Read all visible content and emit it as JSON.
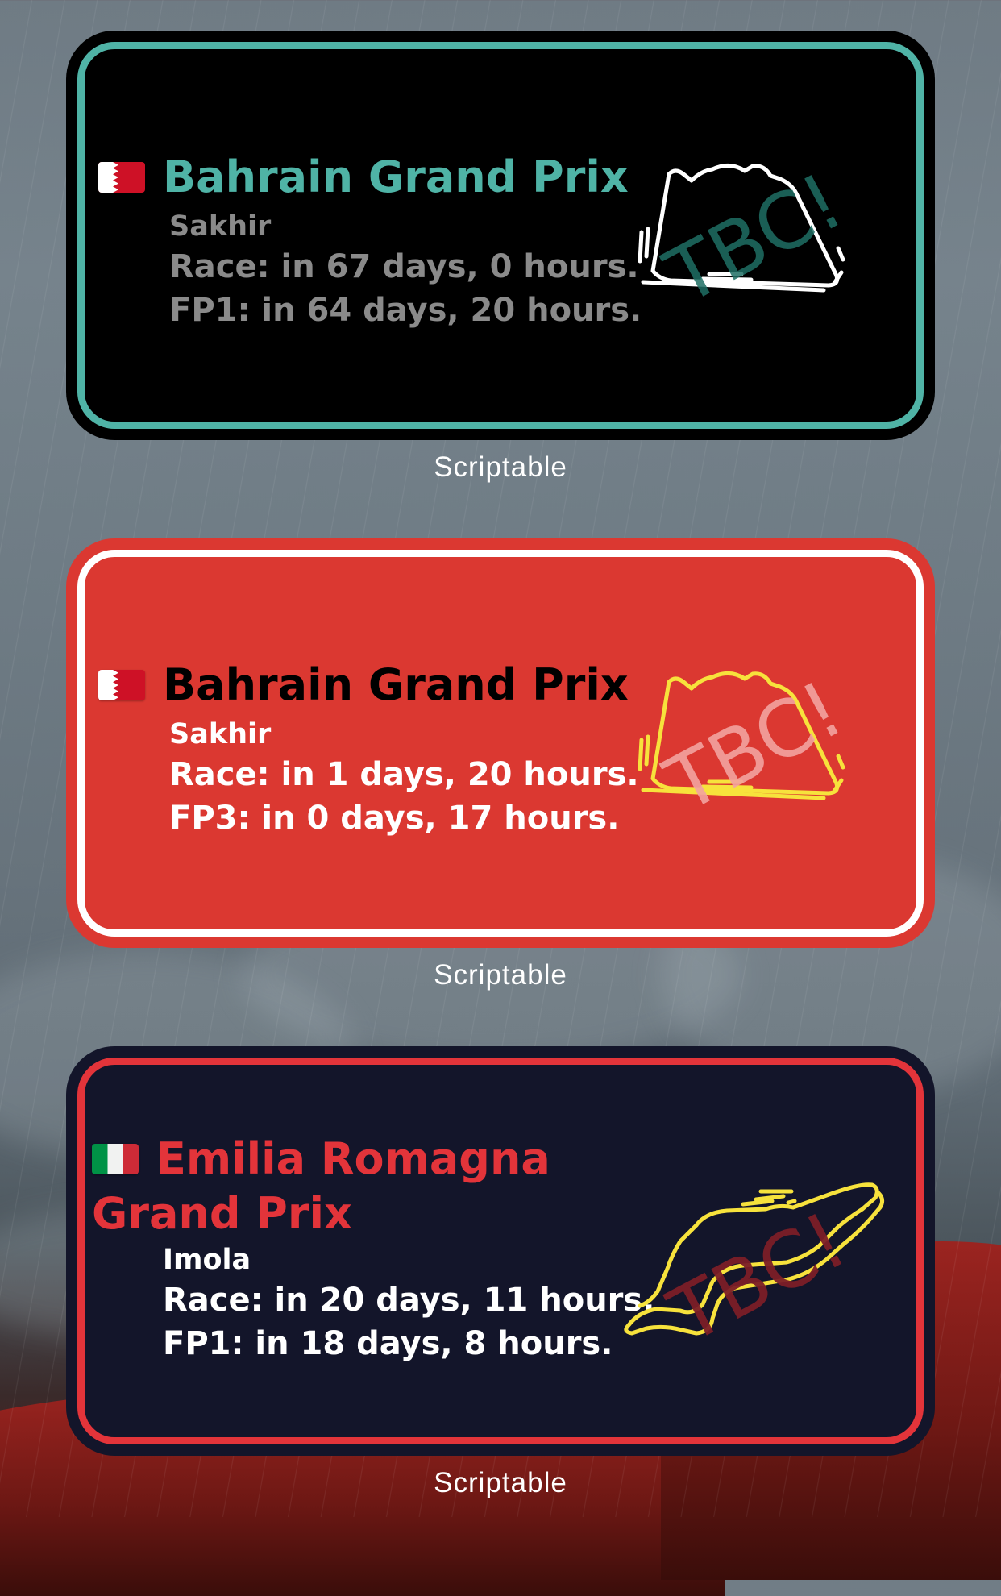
{
  "widgets": [
    {
      "flag": "bahrain-flag",
      "title": "Bahrain Grand Prix",
      "location": "Sakhir",
      "line1": "Race: in 67 days, 0 hours.",
      "line2": "FP1: in 64 days, 20 hours.",
      "badge": "TBC!",
      "caption": "Scriptable",
      "colors": {
        "background": "#000000",
        "border": "#4fb3a6",
        "title": "#4fb3a6",
        "text": "#8a8a8a",
        "track": "#ffffff",
        "badge": "#1f6f64"
      }
    },
    {
      "flag": "bahrain-flag",
      "title": "Bahrain Grand Prix",
      "location": "Sakhir",
      "line1": "Race: in 1 days, 20 hours.",
      "line2": "FP3: in 0 days, 17 hours.",
      "badge": "TBC!",
      "caption": "Scriptable",
      "colors": {
        "background": "#db3831",
        "border": "#ffffff",
        "title": "#000000",
        "text": "#ffffff",
        "track": "#f7e23c",
        "badge": "#f2a3a0"
      }
    },
    {
      "flag": "italy-flag",
      "title_line1": "Emilia Romagna",
      "title_line2": "Grand Prix",
      "location": "Imola",
      "line1": "Race: in 20 days, 11 hours.",
      "line2": "FP1: in 18 days, 8 hours.",
      "badge": "TBC!",
      "caption": "Scriptable",
      "colors": {
        "background": "#13152a",
        "border": "#e3343a",
        "title": "#e3343a",
        "text": "#ffffff",
        "track": "#f7e23c",
        "badge": "#7b1d27"
      }
    }
  ]
}
